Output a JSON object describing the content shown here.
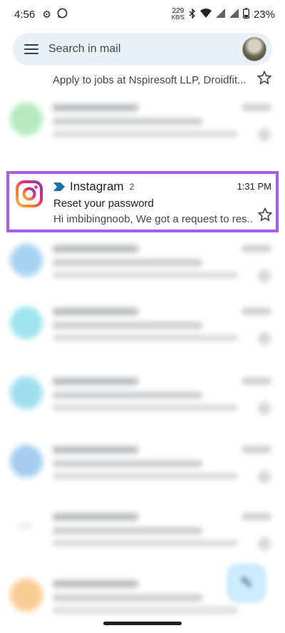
{
  "status_bar": {
    "time": "4:56",
    "net_speed": "229",
    "net_unit": "KB/S",
    "battery": "23%"
  },
  "search": {
    "placeholder": "Search in mail"
  },
  "top_row": {
    "snippet": "Apply to jobs at Nspiresoft LLP, Droidfit..."
  },
  "highlighted_mail": {
    "sender": "Instagram",
    "count": "2",
    "time": "1:31 PM",
    "subject": "Reset your password",
    "preview": "Hi imbibingnoob, We got a request to res..."
  },
  "blurred_rows": [
    {
      "avatar_color": "#9be3a7"
    },
    {
      "avatar_color": "#8bc4ee"
    },
    {
      "avatar_color": "#7fdbe8"
    },
    {
      "avatar_color": "#7fd5e8"
    },
    {
      "avatar_color": "#86bde9"
    },
    {
      "avatar_color": "#d8dadd"
    },
    {
      "avatar_color": "#f9bb72"
    }
  ],
  "colors": {
    "highlight_border": "#a75dea",
    "search_bg": "#eaf1f6",
    "importance_marker": "#1a73a8"
  }
}
